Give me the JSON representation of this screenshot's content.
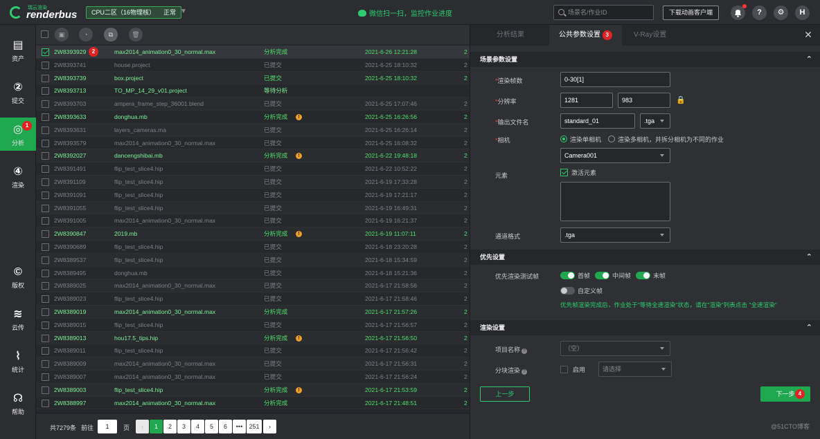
{
  "header": {
    "logo_sub": "瑞云渲染",
    "logo_main": "renderbus",
    "zone_label": "CPU二区（16物理核）",
    "zone_status": "正常",
    "wechat_text": "微信扫一扫，监控作业进度",
    "search_placeholder": "场景名/作业ID",
    "download_client": "下载动画客户端",
    "help_glyph": "?",
    "settings_glyph": "⚙",
    "avatar_letter": "H"
  },
  "sidebar": {
    "items": [
      {
        "label": "资产",
        "glyph": "▤"
      },
      {
        "label": "提交",
        "glyph": "②"
      },
      {
        "label": "分析",
        "glyph": "◎",
        "badge": "1"
      },
      {
        "label": "渲染",
        "glyph": "④"
      },
      {
        "label": "版权",
        "glyph": "©"
      },
      {
        "label": "云传",
        "glyph": "≋"
      },
      {
        "label": "统计",
        "glyph": "⌇"
      },
      {
        "label": "帮助",
        "glyph": "☊"
      }
    ]
  },
  "table": {
    "badge_row1": "2",
    "rows": [
      {
        "id": "2W8393929",
        "file": "max2014_animation0_30_normal.max",
        "status": "分析完成",
        "time": "2021-6-26 12:21:28",
        "extra": "2",
        "type": "sel",
        "warn": false
      },
      {
        "id": "2W8393741",
        "file": "house.project",
        "status": "已提交",
        "time": "2021-6-25 18:10:32",
        "extra": "2",
        "type": "sub",
        "warn": false
      },
      {
        "id": "2W8393739",
        "file": "box.project",
        "status": "已提交",
        "time": "2021-6-25 18:10:32",
        "extra": "2",
        "type": "done",
        "warn": false
      },
      {
        "id": "2W8393713",
        "file": "TO_MP_14_29_v01.project",
        "status": "等待分析",
        "time": "",
        "extra": "",
        "type": "wait",
        "warn": false
      },
      {
        "id": "2W8393703",
        "file": "ampera_frame_step_36001.blend",
        "status": "已提交",
        "time": "2021-6-25 17:07:46",
        "extra": "2",
        "type": "sub",
        "warn": false
      },
      {
        "id": "2W8393633",
        "file": "donghua.mb",
        "status": "分析完成",
        "time": "2021-6-25 16:26:56",
        "extra": "2",
        "type": "done",
        "warn": true
      },
      {
        "id": "2W8393631",
        "file": "layers_cameras.ma",
        "status": "已提交",
        "time": "2021-6-25 16:26:14",
        "extra": "2",
        "type": "sub",
        "warn": false
      },
      {
        "id": "2W8393579",
        "file": "max2014_animation0_30_normal.max",
        "status": "已提交",
        "time": "2021-6-25 16:08:32",
        "extra": "2",
        "type": "sub",
        "warn": false
      },
      {
        "id": "2W8392027",
        "file": "dancengshibai.mb",
        "status": "分析完成",
        "time": "2021-6-22 19:48:18",
        "extra": "2",
        "type": "done",
        "warn": true
      },
      {
        "id": "2W8391491",
        "file": "flip_test_slice4.hip",
        "status": "已提交",
        "time": "2021-6-22 10:52:22",
        "extra": "2",
        "type": "sub",
        "warn": false
      },
      {
        "id": "2W8391109",
        "file": "flip_test_slice4.hip",
        "status": "已提交",
        "time": "2021-6-19 17:33:28",
        "extra": "2",
        "type": "sub",
        "warn": false
      },
      {
        "id": "2W8391091",
        "file": "flip_test_slice4.hip",
        "status": "已提交",
        "time": "2021-6-19 17:21:17",
        "extra": "2",
        "type": "sub",
        "warn": false
      },
      {
        "id": "2W8391055",
        "file": "flip_test_slice4.hip",
        "status": "已提交",
        "time": "2021-6-19 16:49:31",
        "extra": "2",
        "type": "sub",
        "warn": false
      },
      {
        "id": "2W8391005",
        "file": "max2014_animation0_30_normal.max",
        "status": "已提交",
        "time": "2021-6-19 16:21:37",
        "extra": "2",
        "type": "sub",
        "warn": false
      },
      {
        "id": "2W8390847",
        "file": "2019.mb",
        "status": "分析完成",
        "time": "2021-6-19 11:07:11",
        "extra": "2",
        "type": "done",
        "warn": true
      },
      {
        "id": "2W8390689",
        "file": "flip_test_slice4.hip",
        "status": "已提交",
        "time": "2021-6-18 23:20:28",
        "extra": "2",
        "type": "sub",
        "warn": false
      },
      {
        "id": "2W8389537",
        "file": "flip_test_slice4.hip",
        "status": "已提交",
        "time": "2021-6-18 15:34:59",
        "extra": "2",
        "type": "sub",
        "warn": false
      },
      {
        "id": "2W8389495",
        "file": "donghua.mb",
        "status": "已提交",
        "time": "2021-6-18 15:21:36",
        "extra": "2",
        "type": "sub",
        "warn": false
      },
      {
        "id": "2W8389025",
        "file": "max2014_animation0_30_normal.max",
        "status": "已提交",
        "time": "2021-6-17 21:58:56",
        "extra": "2",
        "type": "sub",
        "warn": false
      },
      {
        "id": "2W8389023",
        "file": "flip_test_slice4.hip",
        "status": "已提交",
        "time": "2021-6-17 21:58:46",
        "extra": "2",
        "type": "sub",
        "warn": false
      },
      {
        "id": "2W8389019",
        "file": "max2014_animation0_30_normal.max",
        "status": "分析完成",
        "time": "2021-6-17 21:57:26",
        "extra": "2",
        "type": "done",
        "warn": false
      },
      {
        "id": "2W8389015",
        "file": "flip_test_slice4.hip",
        "status": "已提交",
        "time": "2021-6-17 21:56:57",
        "extra": "2",
        "type": "sub",
        "warn": false
      },
      {
        "id": "2W8389013",
        "file": "hou17.5_tips.hip",
        "status": "分析完成",
        "time": "2021-6-17 21:56:50",
        "extra": "2",
        "type": "done",
        "warn": true
      },
      {
        "id": "2W8389011",
        "file": "flip_test_slice4.hip",
        "status": "已提交",
        "time": "2021-6-17 21:56:42",
        "extra": "2",
        "type": "sub",
        "warn": false
      },
      {
        "id": "2W8389009",
        "file": "max2014_animation0_30_normal.max",
        "status": "已提交",
        "time": "2021-6-17 21:56:31",
        "extra": "2",
        "type": "sub",
        "warn": false
      },
      {
        "id": "2W8389007",
        "file": "max2014_animation0_30_normal.max",
        "status": "已提交",
        "time": "2021-6-17 21:56:24",
        "extra": "2",
        "type": "sub",
        "warn": false
      },
      {
        "id": "2W8389003",
        "file": "flip_test_slice4.hip",
        "status": "分析完成",
        "time": "2021-6-17 21:53:59",
        "extra": "2",
        "type": "done",
        "warn": true
      },
      {
        "id": "2W8388997",
        "file": "max2014_animation0_30_normal.max",
        "status": "分析完成",
        "time": "2021-6-17 21:48:51",
        "extra": "2",
        "type": "done",
        "warn": false
      }
    ]
  },
  "pager": {
    "total": "共7279条",
    "goto": "前往",
    "page_input": "1",
    "page_unit": "页",
    "pages": [
      "1",
      "2",
      "3",
      "4",
      "5",
      "6",
      "•••",
      "251"
    ],
    "prev": "‹",
    "next": "›"
  },
  "panel": {
    "tabs": [
      "分析结果",
      "公共参数设置",
      "V-Ray设置"
    ],
    "active_tab_badge": "3",
    "close": "✕",
    "scene_section": "场景参数设置",
    "frames_label": "渲染帧数",
    "frames_value": "0-30[1]",
    "res_label": "分辨率",
    "res_w": "1281",
    "res_h": "983",
    "output_label": "输出文件名",
    "output_value": "standard_01",
    "output_ext": ".tga",
    "camera_label": "相机",
    "camera_single": "渲染单相机",
    "camera_multi": "渲染多相机，并拆分相机为不同的作业",
    "camera_value": "Camera001",
    "element_label": "元素",
    "element_check": "激活元素",
    "channel_label": "通道格式",
    "channel_value": ".tga",
    "priority_section": "优先设置",
    "priority_label": "优先渲染测试帧",
    "first": "首帧",
    "middle": "中间帧",
    "last": "末帧",
    "custom": "自定义帧",
    "priority_note": "优先帧渲染完成后，作业处于\"等待全速渲染\"状态，请在\"渲染\"列表点击 \"全速渲染\"",
    "render_section": "渲染设置",
    "project_label": "项目名称",
    "project_value": "（空）",
    "tile_label": "分块渲染",
    "tile_enable": "启用",
    "tile_select": "请选择",
    "prev_btn": "上一步",
    "next_btn": "下一步",
    "next_badge": "4"
  },
  "watermark": "@51CTO博客"
}
